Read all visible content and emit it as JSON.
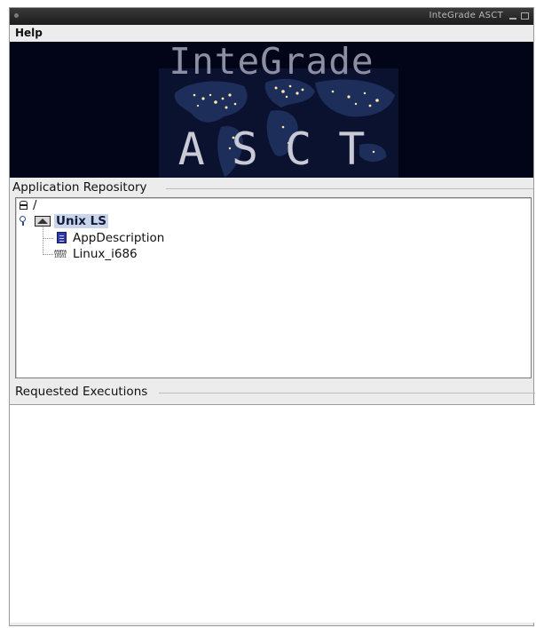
{
  "window": {
    "title": "InteGrade ASCT"
  },
  "menu": {
    "items": [
      "Help"
    ]
  },
  "banner": {
    "top_text": "InteGrade",
    "bottom_text": "A S C T"
  },
  "repository": {
    "section_label": "Application Repository",
    "root_label": "/",
    "application": {
      "label": "Unix LS",
      "children": [
        "AppDescription",
        "Linux_i686"
      ]
    }
  },
  "executions": {
    "section_label": "Requested Executions"
  },
  "colors": {
    "titlebar": "#1c1c1c",
    "banner_background": "#020418",
    "selection_highlight": "#c9d6ea",
    "window_background": "#ececec"
  }
}
